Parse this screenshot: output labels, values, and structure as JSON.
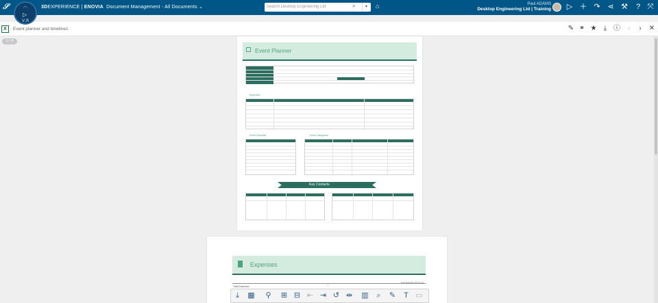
{
  "app": {
    "brand_prefix": "3D",
    "brand_main": "EXPERIENCE",
    "brand_sep": " | ",
    "brand_product": "ENOVIA",
    "app_title": "Document Management - All Documents",
    "compass_label": "V,R"
  },
  "search": {
    "placeholder": "Search Desktop Engineering Ltd"
  },
  "user": {
    "name": "Paul ADAMS",
    "tenant": "Desktop Engineering Ltd | Training"
  },
  "document": {
    "title": "Event planner and timeline1",
    "page_indicator": "1 / 4"
  },
  "page1": {
    "title": "Event Planner",
    "budget_label": "Expenses",
    "checklist_label": "Event Checklist",
    "categories_label": "Event Categories",
    "contacts_label": "Key Contacts"
  },
  "page2": {
    "title": "Expenses",
    "small_left": "Total Expenses",
    "small_right": "ESTIMATED ACTUAL"
  },
  "colors": {
    "topbar": "#005686",
    "accent_green": "#4fa37b",
    "band": "#d4ece0",
    "dark_teal": "#2b6e5f"
  },
  "icons": {
    "top_right": [
      "compass-icon",
      "plus-icon",
      "share-icon",
      "social-icon",
      "tools-icon",
      "help-icon",
      "collapse-icon"
    ],
    "doc_actions": [
      "edit-icon",
      "link-icon",
      "star-icon",
      "download-icon",
      "info-icon",
      "prev-icon",
      "next-icon",
      "close-icon"
    ],
    "pdf_tools": [
      "save-icon",
      "thumbnails-icon",
      "zoom-icon",
      "zoom-in-icon",
      "zoom-out-icon",
      "first-page-icon",
      "last-page-icon",
      "rotate-icon",
      "fit-icon",
      "page-view-icon",
      "find-icon",
      "annotate-icon",
      "text-icon",
      "markup-icon"
    ]
  }
}
